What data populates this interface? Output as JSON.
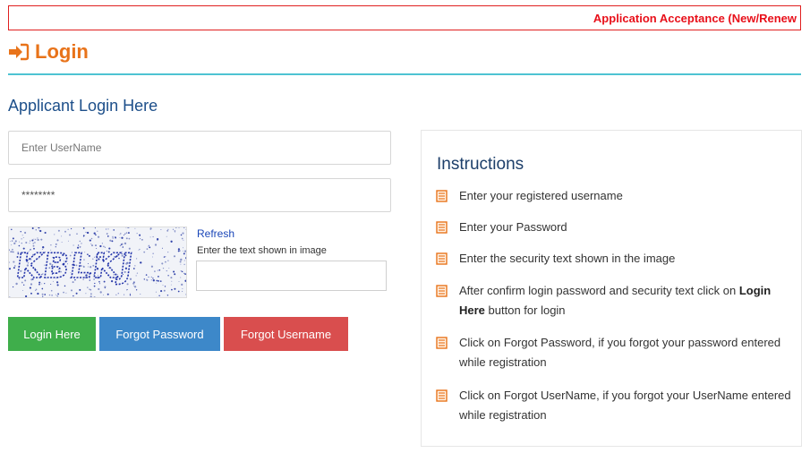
{
  "marquee": {
    "text": "Application Acceptance (New/Renew"
  },
  "header": {
    "title": "Login"
  },
  "form": {
    "section_title": "Applicant Login Here",
    "username_placeholder": "Enter UserName",
    "password_value": "********",
    "captcha": {
      "image_text": "KBLKJ",
      "refresh_label": "Refresh",
      "hint": "Enter the text shown in image"
    },
    "buttons": {
      "login": "Login Here",
      "forgot_password": "Forgot Password",
      "forgot_username": "Forgot Username"
    }
  },
  "instructions": {
    "title": "Instructions",
    "items": [
      {
        "text": "Enter your registered username"
      },
      {
        "text": "Enter your Password"
      },
      {
        "text": "Enter the security text shown in the image"
      },
      {
        "before": "After confirm login password and security text click on ",
        "bold": "Login Here",
        "after": " button for login"
      },
      {
        "text": "Click on Forgot Password, if you forgot your password entered while registration"
      },
      {
        "text": "Click on Forgot UserName, if you forgot your UserName entered while registration"
      }
    ]
  },
  "colors": {
    "accent_orange": "#e8731a",
    "marquee_red": "#e8101a",
    "rule_teal": "#4ec3d2",
    "login_green": "#3fae4b",
    "forgot_blue": "#3d88c9",
    "forgot_red": "#d94e4e",
    "title_blue": "#1d4f8a"
  },
  "icons": {
    "header": "sign-in-arrow-icon",
    "instruction_bullet": "document-list-icon"
  }
}
